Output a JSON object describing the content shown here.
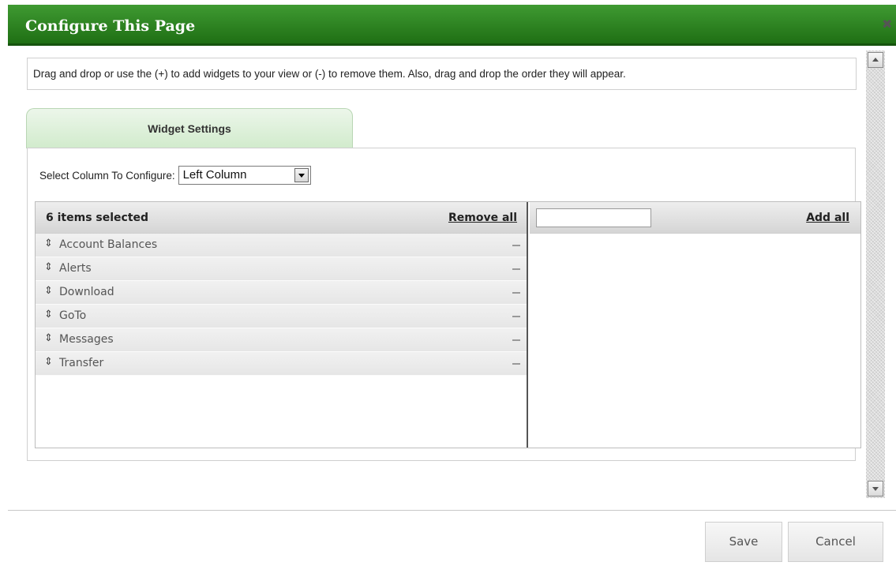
{
  "dialog": {
    "title": "Configure This Page",
    "close_icon": "close-icon",
    "close_glyph": "✖",
    "accent_color": "#2a7f1e"
  },
  "info": {
    "text": "Drag and drop or use the (+) to add widgets to your view or (-) to remove them. Also, drag and drop the order they will appear."
  },
  "tabs": [
    {
      "label": "Widget Settings"
    }
  ],
  "column_select": {
    "label": "Select Column To Configure:",
    "selected": "Left Column"
  },
  "multiselect": {
    "selected_header": "6 items selected",
    "remove_all_label": "Remove all",
    "add_all_label": "Add all",
    "search_value": "",
    "handle_glyph": "⇕",
    "selected_items": [
      {
        "label": "Account Balances"
      },
      {
        "label": "Alerts"
      },
      {
        "label": "Download"
      },
      {
        "label": "GoTo"
      },
      {
        "label": "Messages"
      },
      {
        "label": "Transfer"
      }
    ],
    "available_items": []
  },
  "footer": {
    "save_label": "Save",
    "cancel_label": "Cancel"
  }
}
